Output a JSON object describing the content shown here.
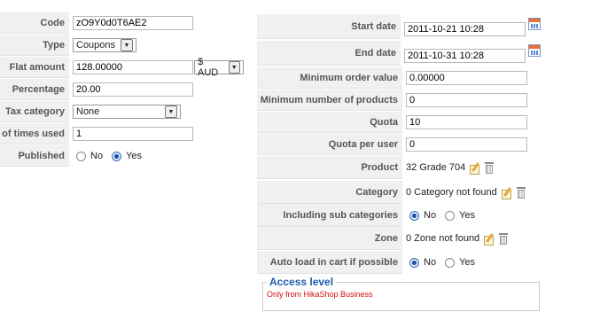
{
  "left": {
    "code": {
      "label": "Code",
      "value": "zO9Y0d0T6AE2"
    },
    "type": {
      "label": "Type",
      "value": "Coupons"
    },
    "flat_amount": {
      "label": "Flat amount",
      "value": "128.00000",
      "currency": "$ AUD"
    },
    "percentage": {
      "label": "Percentage",
      "value": "20.00"
    },
    "tax_category": {
      "label": "Tax category",
      "value": "None"
    },
    "times_used": {
      "label": "of times used",
      "value": "1"
    },
    "published": {
      "label": "Published",
      "no": "No",
      "yes": "Yes",
      "selected": "Yes"
    }
  },
  "right": {
    "start_date": {
      "label": "Start date",
      "value": "2011-10-21 10:28"
    },
    "end_date": {
      "label": "End date",
      "value": "2011-10-31 10:28"
    },
    "min_order": {
      "label": "Minimum order value",
      "value": "0.00000"
    },
    "min_products": {
      "label": "Minimum number of products",
      "value": "0"
    },
    "quota": {
      "label": "Quota",
      "value": "10"
    },
    "quota_user": {
      "label": "Quota per user",
      "value": "0"
    },
    "product": {
      "label": "Product",
      "value": "32 Grade 704"
    },
    "category": {
      "label": "Category",
      "value": "0 Category not found"
    },
    "sub_categories": {
      "label": "Including sub categories",
      "no": "No",
      "yes": "Yes",
      "selected": "No"
    },
    "zone": {
      "label": "Zone",
      "value": "0 Zone not found"
    },
    "auto_load": {
      "label": "Auto load in cart if possible",
      "no": "No",
      "yes": "Yes",
      "selected": "No"
    }
  },
  "access": {
    "legend": "Access level",
    "text": "Only from HikaShop Business"
  },
  "icons": {
    "calendar": "calendar-icon",
    "edit": "edit-icon",
    "delete": "trash-icon"
  },
  "colors": {
    "label_bg": "#f0f0f0",
    "legend": "#1e5ca8",
    "warning": "#d01010"
  }
}
